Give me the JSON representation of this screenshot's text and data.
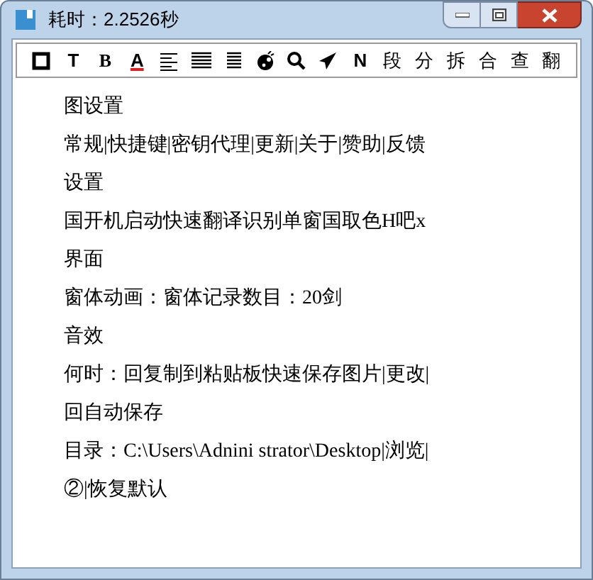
{
  "window": {
    "title": "耗时：2.2526秒"
  },
  "toolbar": [
    "T",
    "B",
    "A",
    "N",
    "段",
    "分",
    "拆",
    "合",
    "查",
    "翻"
  ],
  "lines": [
    "图设置",
    "常规|快捷键|密钥代理|更新|关于|赞助|反馈",
    "设置",
    "国开机启动快速翻译识别单窗国取色H吧x",
    "界面",
    "窗体动画：窗体记录数目：20剑",
    "音效",
    "何时：回复制到粘贴板快速保存图片|更改|",
    "回自动保存",
    "目录：C:\\Users\\Adnini strator\\Desktop|浏览|",
    "②|恢复默认"
  ]
}
